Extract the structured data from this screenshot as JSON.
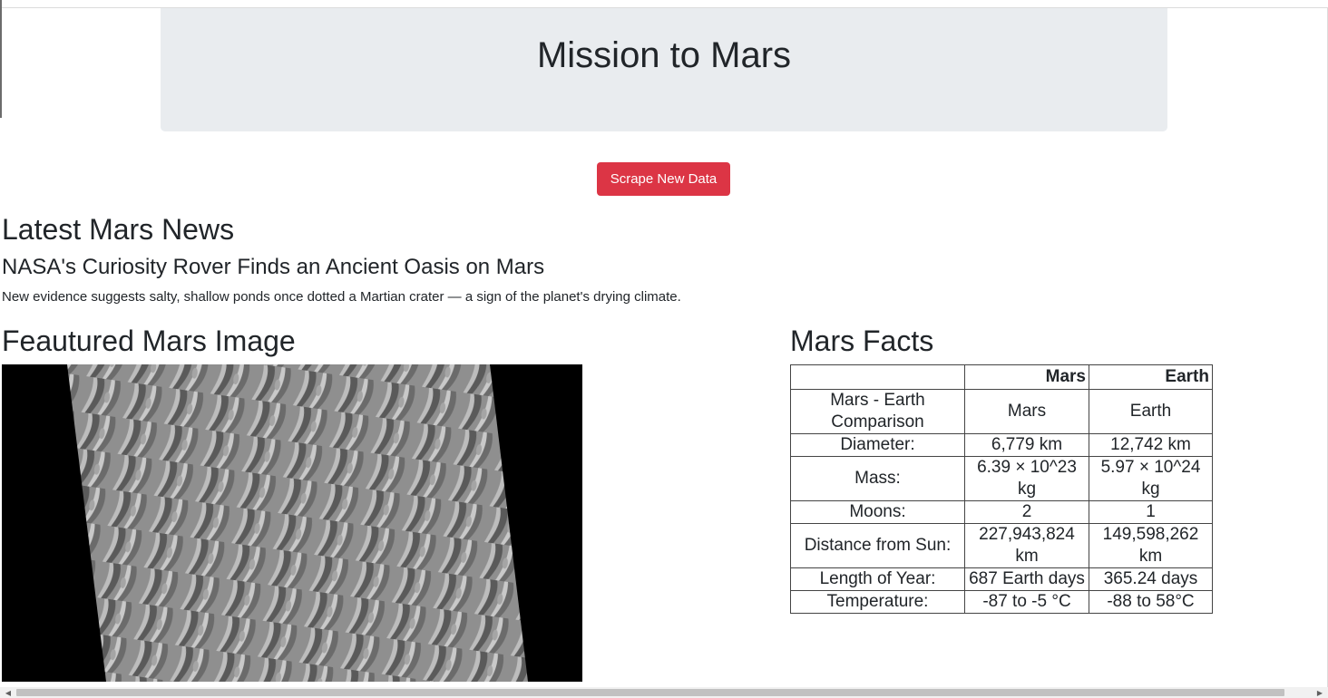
{
  "header": {
    "title": "Mission to Mars"
  },
  "actions": {
    "scrape_label": "Scrape New Data"
  },
  "news": {
    "heading": "Latest Mars News",
    "title": "NASA's Curiosity Rover Finds an Ancient Oasis on Mars",
    "paragraph": "New evidence suggests salty, shallow ponds once dotted a Martian crater — a sign of the planet's drying climate."
  },
  "featured": {
    "heading": "Feautured Mars Image"
  },
  "facts": {
    "heading": "Mars Facts",
    "columns": [
      "",
      "Mars",
      "Earth"
    ],
    "rows": [
      {
        "label": "Mars - Earth Comparison",
        "mars": "Mars",
        "earth": "Earth"
      },
      {
        "label": "Diameter:",
        "mars": "6,779 km",
        "earth": "12,742 km"
      },
      {
        "label": "Mass:",
        "mars": "6.39 × 10^23 kg",
        "earth": "5.97 × 10^24 kg"
      },
      {
        "label": "Moons:",
        "mars": "2",
        "earth": "1"
      },
      {
        "label": "Distance from Sun:",
        "mars": "227,943,824 km",
        "earth": "149,598,262 km"
      },
      {
        "label": "Length of Year:",
        "mars": "687 Earth days",
        "earth": "365.24 days"
      },
      {
        "label": "Temperature:",
        "mars": "-87 to -5 °C",
        "earth": "-88 to 58°C"
      }
    ]
  },
  "colors": {
    "jumbotron_bg": "#e9ecef",
    "button_danger": "#dc3545",
    "text": "#212529"
  },
  "icons": {
    "scroll_left": "triangle-left-icon",
    "scroll_right": "triangle-right-icon"
  }
}
